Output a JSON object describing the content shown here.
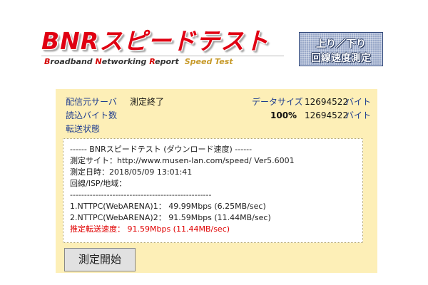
{
  "logo": {
    "title": "BNRスピードテスト",
    "sub_b": "B",
    "sub_roadband": "roadband ",
    "sub_n": "N",
    "sub_etworking": "etworking ",
    "sub_r": "R",
    "sub_eport": "eport",
    "sub_speedtest": "Speed Test"
  },
  "updown_button": {
    "line1": "上り／下り",
    "line2": "回線速度測定"
  },
  "status": {
    "server_label": "配信元サーバ",
    "server_status": "測定終了",
    "read_bytes_label": "読込バイト数",
    "transfer_label": "転送状態",
    "data_size_label": "データサイズ",
    "data_size_value": "12694522",
    "data_size_unit": "バイト",
    "percent": "100%",
    "read_bytes_value": "12694522",
    "read_bytes_unit": "バイト"
  },
  "result": {
    "lines": [
      "------ BNRスピードテスト (ダウンロード速度) ------",
      "測定サイト：http://www.musen-lan.com/speed/ Ver5.6001",
      "測定日時：2018/05/09 13:01:41",
      "回線/ISP/地域：",
      "--------------------------------------------------",
      "1.NTTPC(WebARENA)1：  49.99Mbps (6.25MB/sec)",
      "2.NTTPC(WebARENA)2：  91.59Mbps (11.44MB/sec)"
    ],
    "estimate": "推定転送速度： 91.59Mbps (11.44MB/sec)"
  },
  "start_button": {
    "label": "測定開始"
  },
  "colors": {
    "panel_bg": "#fdefb7",
    "link_blue": "#1e3c8f",
    "logo_red": "#e00012",
    "estimate_red": "#e00000"
  }
}
